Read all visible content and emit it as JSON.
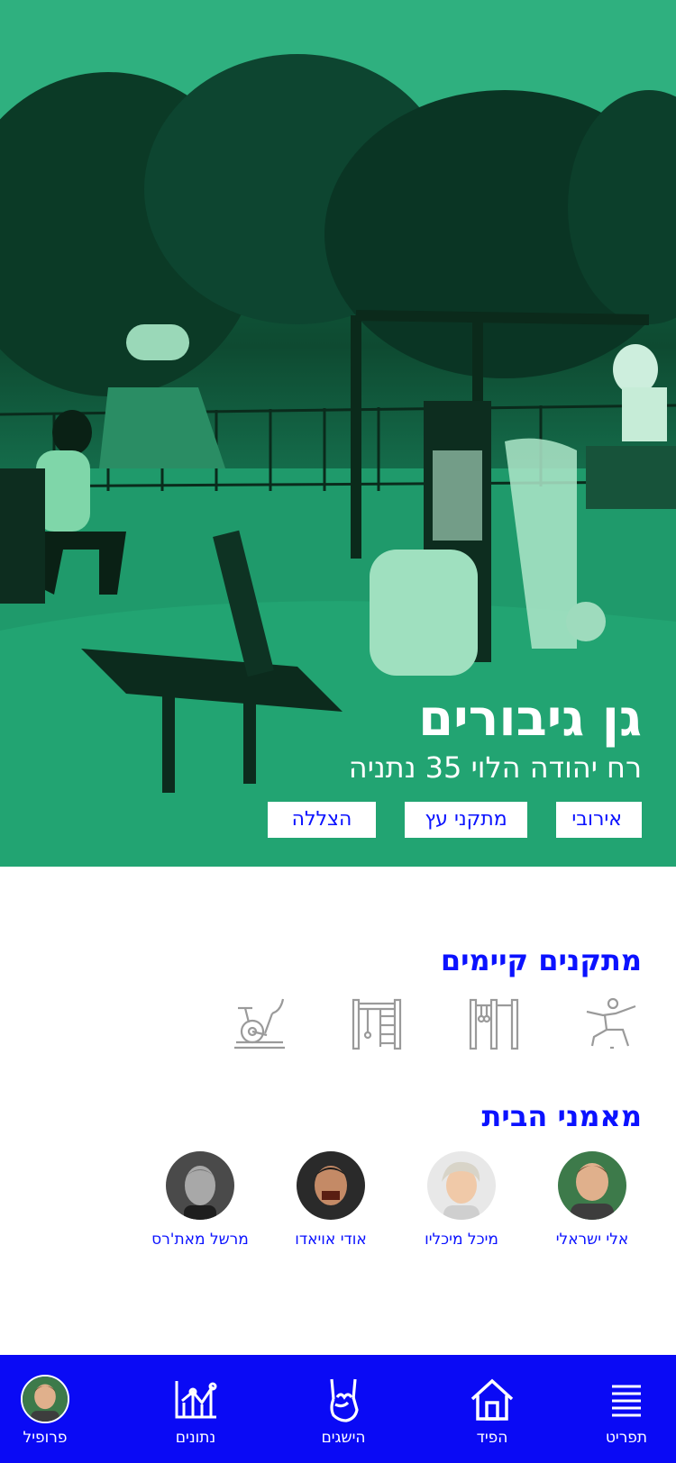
{
  "hero": {
    "title": "גן גיבורים",
    "address": "רח יהודה הלוי 35 נתניה",
    "tags": [
      "אירובי",
      "מתקני עץ",
      "הצללה"
    ]
  },
  "equipment": {
    "title": "מתקנים קיימים",
    "icons": [
      "stretching-person-icon",
      "pull-up-bars-icon",
      "climbing-ladder-icon",
      "exercise-bike-icon"
    ]
  },
  "trainers": {
    "title": "מאמני הבית",
    "items": [
      {
        "name": "אלי ישראלי"
      },
      {
        "name": "מיכל מיכליו"
      },
      {
        "name": "אודי אויאדו"
      },
      {
        "name": "מרשל מאת'רס"
      }
    ]
  },
  "nav": {
    "items": [
      {
        "label": "תפריט",
        "icon": "menu-icon"
      },
      {
        "label": "הפיד",
        "icon": "home-icon"
      },
      {
        "label": "הישגים",
        "icon": "rock-hand-icon"
      },
      {
        "label": "נתונים",
        "icon": "chart-icon"
      },
      {
        "label": "פרופיל",
        "icon": "avatar"
      }
    ]
  },
  "colors": {
    "accent": "#0b12ff",
    "nav_bg": "#0a0af5",
    "hero_tint": "#1c9a6a"
  }
}
